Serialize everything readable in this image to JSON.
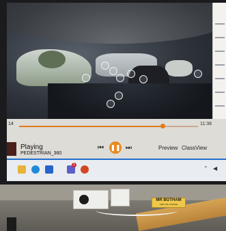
{
  "player": {
    "time_start": "14",
    "time_end": "11:38",
    "progress": 0.8,
    "status": "Playing",
    "track": "PEDESTRIAN_360",
    "preview_label": "Preview",
    "classview_label": "ClassView",
    "prev_icon": "skip-previous",
    "play_pause_icon": "pause",
    "next_icon": "skip-next"
  },
  "taskbar": {
    "apps": [
      "files-icon",
      "edge-icon",
      "store-icon",
      "teams-icon",
      "powerpoint-icon"
    ],
    "teams_badge": "1"
  },
  "nameplate": {
    "name": "MR BOTHAM",
    "subtitle": "ARE THE CHANGE"
  },
  "colors": {
    "accent": "#e88a22",
    "taskbar_line": "#1f6fd1"
  }
}
